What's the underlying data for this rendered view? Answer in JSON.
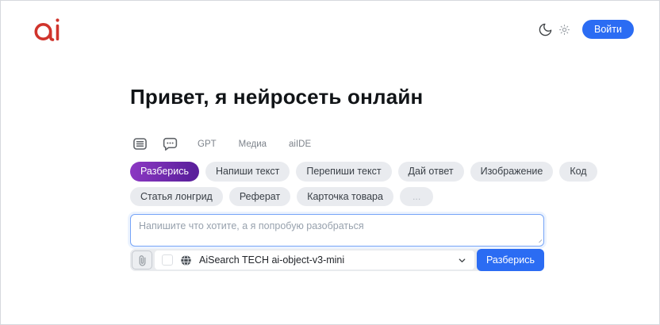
{
  "header": {
    "logo_text": "ai",
    "login_button": "Войти"
  },
  "hero": {
    "title": "Привет, я нейросеть онлайн"
  },
  "mode_tabs": {
    "labels": [
      "GPT",
      "Медиа",
      "aiIDE"
    ]
  },
  "presets": {
    "selected": "Разберись",
    "row1": [
      "Разберись",
      "Напиши текст",
      "Перепиши текст",
      "Дай ответ",
      "Изображение",
      "Код"
    ],
    "row2": [
      "Статья лонгрид",
      "Реферат",
      "Карточка товара",
      "..."
    ]
  },
  "composer": {
    "placeholder": "Напишите что хотите, а я попробую разобраться",
    "model_select_value": "AiSearch TECH ai-object-v3-mini",
    "submit_button": "Разберись"
  },
  "colors": {
    "logo_red": "#d0342c",
    "accent_blue": "#2b6cf3",
    "selected_pill_gradient_start": "#8d39c4",
    "selected_pill_gradient_end": "#5b1f9c",
    "pill_background": "#e9ebef",
    "bar_background": "#e9ebee",
    "textarea_border": "#76a4f7"
  }
}
